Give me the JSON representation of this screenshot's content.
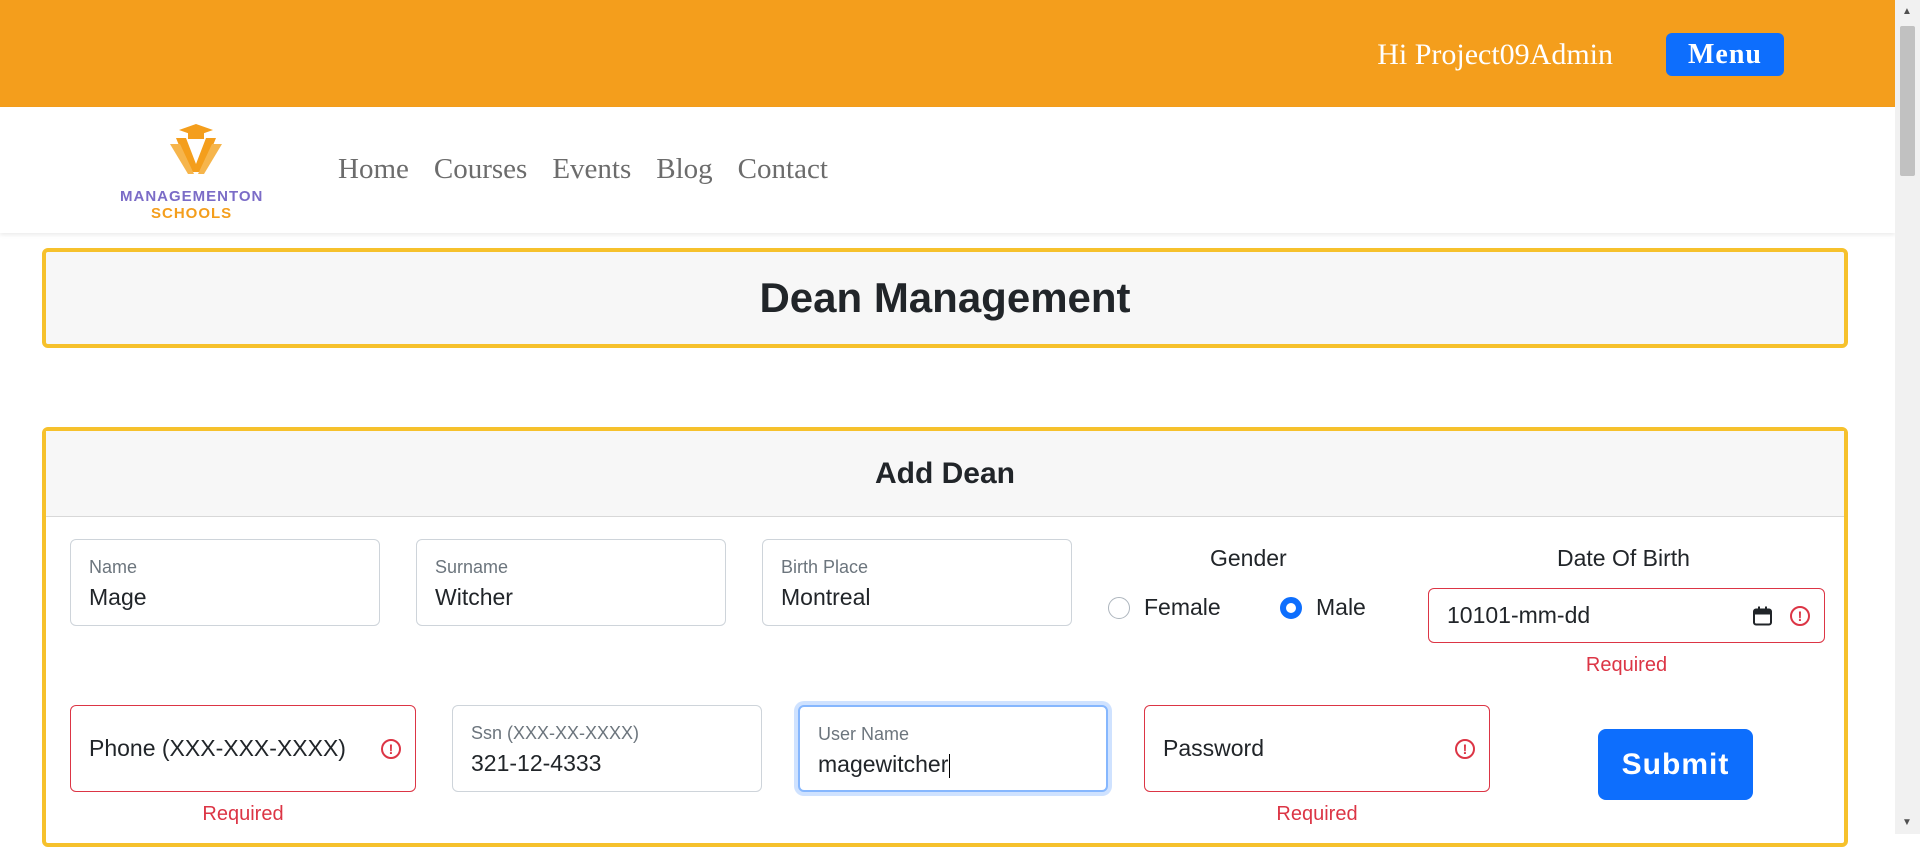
{
  "header": {
    "greeting": "Hi Project09Admin",
    "menu_label": "Menu"
  },
  "logo": {
    "line1": "MANAGEMENTON",
    "line2": "SCHOOLS"
  },
  "nav": {
    "items": [
      "Home",
      "Courses",
      "Events",
      "Blog",
      "Contact"
    ]
  },
  "page": {
    "title": "Dean Management"
  },
  "form": {
    "title": "Add Dean",
    "name": {
      "label": "Name",
      "value": "Mage"
    },
    "surname": {
      "label": "Surname",
      "value": "Witcher"
    },
    "birth_place": {
      "label": "Birth Place",
      "value": "Montreal"
    },
    "gender": {
      "label": "Gender",
      "options": [
        "Female",
        "Male"
      ],
      "selected": "Male"
    },
    "date_of_birth": {
      "label": "Date Of Birth",
      "value": "10101-mm-dd",
      "error": "Required"
    },
    "phone": {
      "placeholder": "Phone (XXX-XXX-XXXX)",
      "error": "Required"
    },
    "ssn": {
      "label": "Ssn (XXX-XX-XXXX)",
      "value": "321-12-4333"
    },
    "username": {
      "label": "User Name",
      "value": "magewitcher"
    },
    "password": {
      "placeholder": "Password",
      "error": "Required"
    },
    "submit_label": "Submit"
  },
  "colors": {
    "topbar": "#f49e1c",
    "accent": "#0d6efd",
    "border_highlight": "#f6c12c",
    "error": "#dc3545"
  }
}
